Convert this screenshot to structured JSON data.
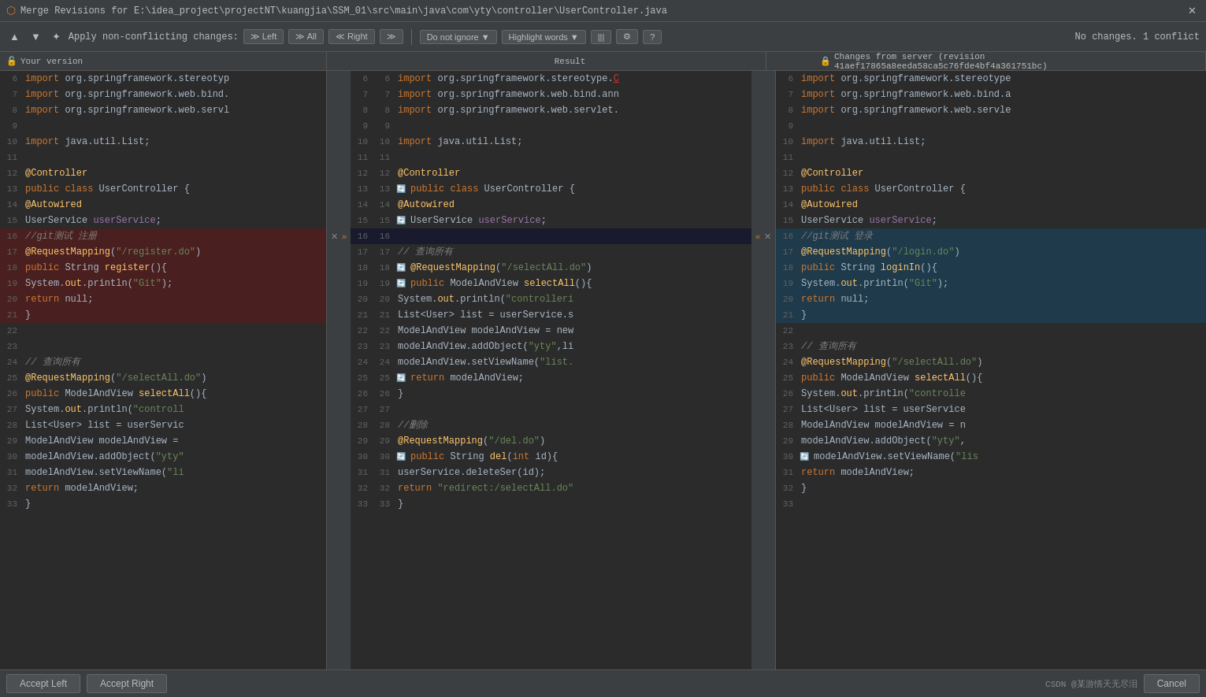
{
  "titleBar": {
    "icon": "⬡",
    "title": "Merge Revisions for E:\\idea_project\\projectNT\\kuangjia\\SSM_01\\src\\main\\java\\com\\yty\\controller\\UserController.java",
    "closeBtn": "✕"
  },
  "toolbar": {
    "prevBtn": "▲",
    "nextBtn": "▼",
    "magicBtn": "✦",
    "applyLabel": "Apply non-conflicting changes:",
    "leftBtn": "≫ Left",
    "allBtn": "≫ All",
    "rightBtn": "Right ≫",
    "applyRightBtn": "≫",
    "ignoreBtn": "Do not ignore",
    "highlightBtn": "Highlight words",
    "barBtn": "|||",
    "gearBtn": "⚙",
    "helpBtn": "?",
    "noChangesText": "No changes. 1 conflict"
  },
  "headers": {
    "yourVersion": "Your version",
    "result": "Result",
    "serverVersion": "Changes from server (revision 41aef17865a8eeda58ca5c76fde4bf4a361751bc)"
  },
  "bottomBar": {
    "acceptLeft": "Accept Left",
    "acceptRight": "Accept Right",
    "watermark": "CSDN @某游情天无尽泪"
  },
  "leftPanel": {
    "lines": [
      {
        "num": 6,
        "code": "import org.springframework.stereotyp",
        "type": "import"
      },
      {
        "num": 7,
        "code": "import org.springframework.web.bind.",
        "type": "import"
      },
      {
        "num": 8,
        "code": "import org.springframework.web.servl",
        "type": "import"
      },
      {
        "num": 9,
        "code": "",
        "type": "blank"
      },
      {
        "num": 10,
        "code": "import java.util.List;",
        "type": "import"
      },
      {
        "num": 11,
        "code": "",
        "type": "blank"
      },
      {
        "num": 12,
        "code": "@Controller",
        "type": "annotation"
      },
      {
        "num": 13,
        "code": "public class UserController {",
        "type": "code"
      },
      {
        "num": 14,
        "code": "    @Autowired",
        "type": "annotation"
      },
      {
        "num": 15,
        "code": "    UserService userService;",
        "type": "code"
      },
      {
        "num": 16,
        "code": "    //git测试  注册",
        "type": "comment-conflict"
      },
      {
        "num": 17,
        "code": "    @RequestMapping(\"/register.do\")",
        "type": "code-conflict"
      },
      {
        "num": 18,
        "code": "    public String register(){",
        "type": "code-conflict"
      },
      {
        "num": 19,
        "code": "        System.out.println(\"Git\");",
        "type": "code-conflict"
      },
      {
        "num": 20,
        "code": "        return null;",
        "type": "code-conflict"
      },
      {
        "num": 21,
        "code": "    }",
        "type": "code-conflict"
      },
      {
        "num": 22,
        "code": "",
        "type": "blank"
      },
      {
        "num": 23,
        "code": "",
        "type": "blank"
      },
      {
        "num": 24,
        "code": "    // 查询所有",
        "type": "comment"
      },
      {
        "num": 25,
        "code": "    @RequestMapping(\"/selectAll.do\")",
        "type": "code"
      },
      {
        "num": 26,
        "code": "    public ModelAndView selectAll(){",
        "type": "code"
      },
      {
        "num": 27,
        "code": "        System.out.println(\"controll",
        "type": "code"
      },
      {
        "num": 28,
        "code": "        List<User> list = userServic",
        "type": "code"
      },
      {
        "num": 29,
        "code": "        ModelAndView modelAndView =",
        "type": "code"
      },
      {
        "num": 30,
        "code": "        modelAndView.addObject(\"yty\"",
        "type": "code"
      },
      {
        "num": 31,
        "code": "        modelAndView.setViewName(\"li",
        "type": "code"
      },
      {
        "num": 32,
        "code": "        return modelAndView;",
        "type": "code"
      },
      {
        "num": 33,
        "code": "    }",
        "type": "code"
      }
    ]
  },
  "rightPanel": {
    "lines": [
      {
        "num": 6,
        "code": "import org.springframework.stereotype",
        "type": "import"
      },
      {
        "num": 7,
        "code": "import org.springframework.web.bind.a",
        "type": "import"
      },
      {
        "num": 8,
        "code": "import org.springframework.web.servle",
        "type": "import"
      },
      {
        "num": 9,
        "code": "",
        "type": "blank"
      },
      {
        "num": 10,
        "code": "import java.util.List;",
        "type": "import"
      },
      {
        "num": 11,
        "code": "",
        "type": "blank"
      },
      {
        "num": 12,
        "code": "@Controller",
        "type": "annotation"
      },
      {
        "num": 13,
        "code": "public class UserController {",
        "type": "code"
      },
      {
        "num": 14,
        "code": "    @Autowired",
        "type": "annotation"
      },
      {
        "num": 15,
        "code": "    UserService userService;",
        "type": "code"
      },
      {
        "num": 16,
        "code": "    //git测试  登录",
        "type": "comment-conflict"
      },
      {
        "num": 17,
        "code": "    @RequestMapping(\"/login.do\")",
        "type": "code-conflict"
      },
      {
        "num": 18,
        "code": "    public String loginIn(){",
        "type": "code-conflict"
      },
      {
        "num": 19,
        "code": "        System.out.println(\"Git\");",
        "type": "code-conflict"
      },
      {
        "num": 20,
        "code": "        return null;",
        "type": "code-conflict"
      },
      {
        "num": 21,
        "code": "    }",
        "type": "code-conflict"
      },
      {
        "num": 22,
        "code": "",
        "type": "blank"
      },
      {
        "num": 23,
        "code": "    // 查询所有",
        "type": "comment"
      },
      {
        "num": 24,
        "code": "    @RequestMapping(\"/selectAll.do\")",
        "type": "code"
      },
      {
        "num": 25,
        "code": "    public ModelAndView selectAll(){",
        "type": "code"
      },
      {
        "num": 26,
        "code": "        System.out.println(\"controlle",
        "type": "code"
      },
      {
        "num": 27,
        "code": "        List<User> list = userService",
        "type": "code"
      },
      {
        "num": 28,
        "code": "        ModelAndView modelAndView = n",
        "type": "code"
      },
      {
        "num": 29,
        "code": "        modelAndView.addObject(\"yty\",",
        "type": "code"
      },
      {
        "num": 30,
        "code": "        modelAndView.setViewName(\"lis",
        "type": "code"
      },
      {
        "num": 31,
        "code": "        return modelAndView;",
        "type": "code"
      },
      {
        "num": 32,
        "code": "    }",
        "type": "code"
      },
      {
        "num": 33,
        "code": "",
        "type": "blank"
      }
    ]
  }
}
